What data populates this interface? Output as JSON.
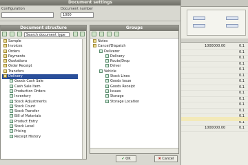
{
  "window": {
    "title": "Document settings"
  },
  "top_fields": {
    "left_label": "Configuration",
    "left_value": "",
    "right_label": "Document number",
    "right_value": "1000"
  },
  "left_panel": {
    "title": "Document structure",
    "search_value": "Search document type",
    "items": [
      {
        "label": "Sample",
        "indent": 0
      },
      {
        "label": "Invoices",
        "indent": 0
      },
      {
        "label": "Orders",
        "indent": 0
      },
      {
        "label": "Payments",
        "indent": 0
      },
      {
        "label": "Quotations",
        "indent": 0
      },
      {
        "label": "Order Receipt",
        "indent": 0
      },
      {
        "label": "Transfers",
        "indent": 0
      },
      {
        "label": "Delivery",
        "indent": 0,
        "selected": true
      },
      {
        "label": "Goods Cash Sale",
        "indent": 1
      },
      {
        "label": "Cash Sale Item",
        "indent": 1
      },
      {
        "label": "Production Orders",
        "indent": 1
      },
      {
        "label": "Inventory",
        "indent": 1
      },
      {
        "label": "Stock Adjustments",
        "indent": 1
      },
      {
        "label": "Stock Count",
        "indent": 1
      },
      {
        "label": "Stock Transfer",
        "indent": 1
      },
      {
        "label": "Bill of Materials",
        "indent": 1
      },
      {
        "label": "Product Entry",
        "indent": 1
      },
      {
        "label": "Stock Level",
        "indent": 1
      },
      {
        "label": "Pricing",
        "indent": 1
      },
      {
        "label": "Receipt History",
        "indent": 1
      }
    ]
  },
  "right_panel": {
    "title": "Groups",
    "items": [
      {
        "label": "Notes",
        "indent": 0
      },
      {
        "label": "Cancel/Dispatch",
        "indent": 0
      },
      {
        "label": "Deliverer",
        "indent": 1
      },
      {
        "label": "Delivery",
        "indent": 2
      },
      {
        "label": "Route/Drop",
        "indent": 2
      },
      {
        "label": "Driver",
        "indent": 2
      },
      {
        "label": "Vehicle",
        "indent": 1
      },
      {
        "label": "Stock Lines",
        "indent": 2
      },
      {
        "label": "Goods Issue",
        "indent": 2
      },
      {
        "label": "Goods Receipt",
        "indent": 2
      },
      {
        "label": "Issues",
        "indent": 2
      },
      {
        "label": "Storage",
        "indent": 2
      },
      {
        "label": "Storage Location",
        "indent": 2
      }
    ]
  },
  "buttons": {
    "ok_label": "OK",
    "cancel_label": "Cancel"
  },
  "background_grid": {
    "rows": [
      {
        "c1": "",
        "c2": "1000000.00",
        "c3": "0.1"
      },
      {
        "c1": "",
        "c2": "",
        "c3": "0.1"
      },
      {
        "c1": "",
        "c2": "",
        "c3": "0.1"
      },
      {
        "c1": "",
        "c2": "",
        "c3": "0.1"
      },
      {
        "c1": "",
        "c2": "",
        "c3": "0.1"
      },
      {
        "c1": "",
        "c2": "",
        "c3": "0.1"
      },
      {
        "c1": "",
        "c2": "",
        "c3": "0.1"
      },
      {
        "c1": "",
        "c2": "",
        "c3": "0.1"
      },
      {
        "c1": "",
        "c2": "",
        "c3": "0.1"
      },
      {
        "c1": "",
        "c2": "",
        "c3": "0.1"
      },
      {
        "c1": "",
        "c2": "",
        "c3": "0.1"
      },
      {
        "c1": "",
        "c2": "",
        "c3": "0.1"
      },
      {
        "c1": "",
        "c2": "",
        "c3": "0.1"
      },
      {
        "c1": "",
        "c2": "",
        "c3": "0.1"
      },
      {
        "c1": "",
        "c2": "1000000.00",
        "c3": "0.1"
      }
    ]
  }
}
